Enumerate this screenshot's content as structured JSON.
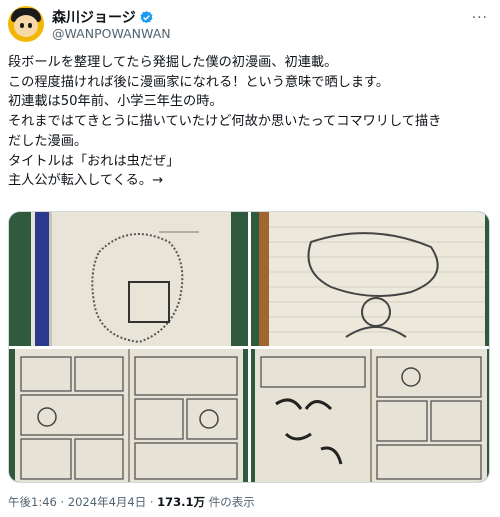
{
  "user": {
    "display_name": "森川ジョージ",
    "handle": "@WANPOWANWAN",
    "verified": true,
    "avatar_icon": "avatar-icon"
  },
  "more_label": "···",
  "tweet": {
    "lines": [
      "段ボールを整理してたら発掘した僕の初漫画、初連載。",
      "この程度描ければ後に漫画家になれる！という意味で晒します。",
      "初連載は50年前、小学三年生の時。",
      "それまではてきとうに描いていたけど何故か思いたってコマワリして描き",
      "だした漫画。",
      "タイトルは「おれは虫だぜ」",
      "主人公が転入してくる。→"
    ]
  },
  "media": {
    "tiles": [
      "manga-page-1",
      "manga-page-2",
      "manga-page-3",
      "manga-page-4"
    ],
    "colors": {
      "board": "#2f5a3d",
      "paper": "#e8e4d8",
      "binder": "#2b3a8c"
    }
  },
  "meta": {
    "time": "午後1:46",
    "separator": " · ",
    "date": "2024年4月4日",
    "views_count": "173.1万",
    "views_label": " 件の表示"
  },
  "colors": {
    "text": "#0f1419",
    "secondary": "#536471",
    "verified": "#1d9bf0"
  }
}
